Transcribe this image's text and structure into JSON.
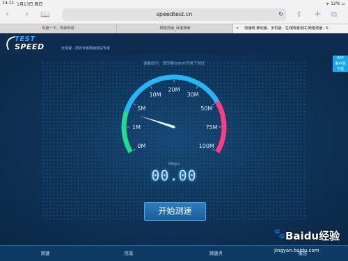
{
  "status_bar": {
    "time": "14:11",
    "date": "1月13日 周日",
    "right": "ᯤ 12% ▭"
  },
  "safari": {
    "url": "speedtest.cn",
    "icons": {
      "back": "chevron-left-icon",
      "forward": "chevron-right-icon",
      "bookmarks": "book-icon",
      "reload": "reload-icon",
      "share": "share-icon",
      "new_tab": "plus-icon",
      "tabs": "tabs-icon"
    }
  },
  "tabs": [
    {
      "label": "百度一下，你就知道"
    },
    {
      "label": "网络测速_百度搜索"
    },
    {
      "label": "测速网 移动版、手机版 - 在线网速测试,网络测速 - S",
      "close": "✕"
    }
  ],
  "header": {
    "logo_line1": "TEST",
    "logo_line2": "SPEED",
    "slogan": "云测速 - 您的专属网速测试专家"
  },
  "notice": "温馨提示：请尽量在WiFi环境下测试",
  "app_badge": {
    "line1": "APP",
    "line2": "客户端",
    "line3": "下载"
  },
  "gauge": {
    "ticks": [
      "0M",
      "1M",
      "5M",
      "10M",
      "20M",
      "30M",
      "50M",
      "75M",
      "100M"
    ],
    "unit": "Mbps",
    "value": "00.00",
    "needle_value": 0.2,
    "colors": {
      "low": "#1fdc8e",
      "mid": "#27b6f5",
      "high": "#ff3c84"
    }
  },
  "start_button": "开始测速",
  "bottom_nav": [
    "测速",
    "信息",
    "测速点",
    "报告"
  ],
  "watermark": {
    "brand": "Baidu经验",
    "url": "jingyan.baidu.com"
  }
}
